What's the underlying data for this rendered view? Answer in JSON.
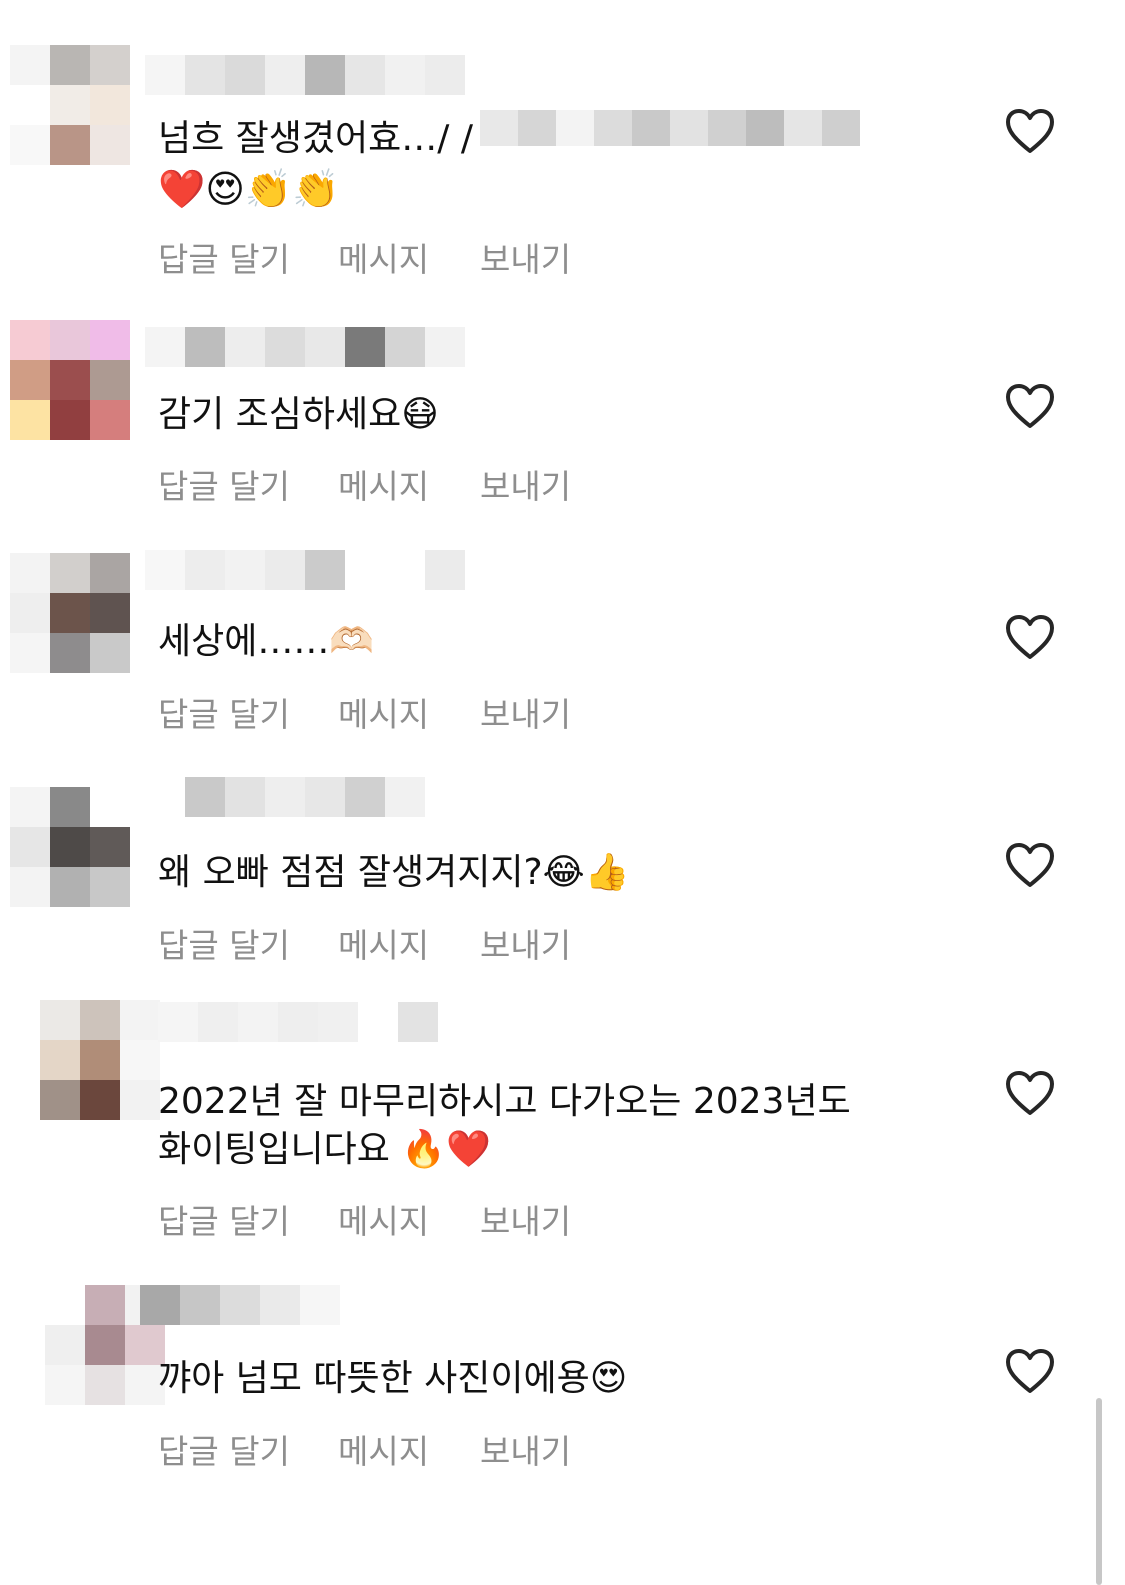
{
  "comments": [
    {
      "text": "넘흐 잘생겼어효…/ /",
      "emoji": "❤️😍👏👏",
      "reply_label": "답글 달기",
      "message_label": "메시지",
      "send_label": "보내기"
    },
    {
      "text": "감기 조심하세요😷",
      "reply_label": "답글 달기",
      "message_label": "메시지",
      "send_label": "보내기"
    },
    {
      "text": "세상에……🫶🏻",
      "reply_label": "답글 달기",
      "message_label": "메시지",
      "send_label": "보내기"
    },
    {
      "text": "왜 오빠 점점 잘생겨지지?😂👍",
      "reply_label": "답글 달기",
      "message_label": "메시지",
      "send_label": "보내기"
    },
    {
      "text": "2022년 잘 마무리하시고 다가오는 2023년도\n화이팅입니다요 🔥❤️",
      "reply_label": "답글 달기",
      "message_label": "메시지",
      "send_label": "보내기"
    },
    {
      "text": "꺄아 넘모 따뜻한 사진이에용😍",
      "reply_label": "답글 달기",
      "message_label": "메시지",
      "send_label": "보내기"
    }
  ],
  "icons": {
    "like": "heart-outline-icon"
  },
  "colors": {
    "text": "#111111",
    "secondary_text": "#8e8e8e",
    "heart_stroke": "#262626"
  }
}
